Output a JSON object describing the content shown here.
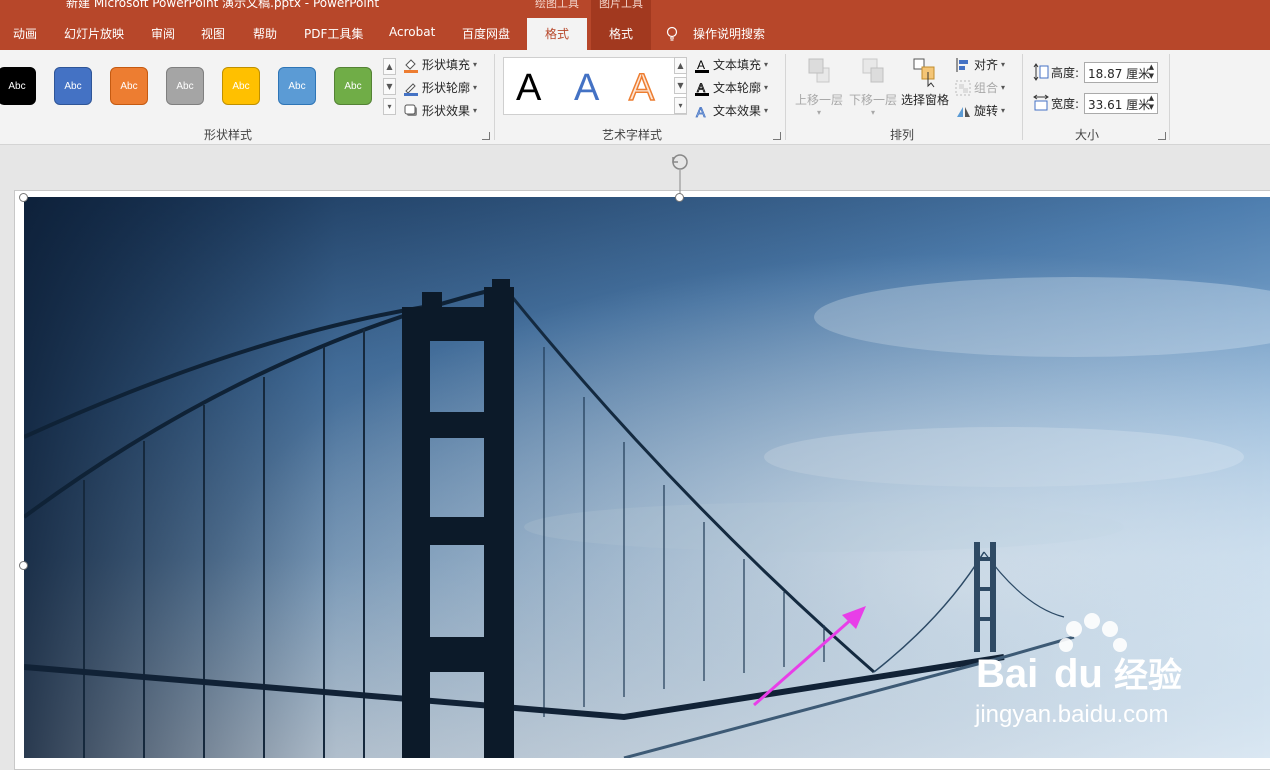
{
  "window": {
    "title": "新建 Microsoft PowerPoint 演示文稿.pptx  -  PowerPoint"
  },
  "context_tabs": {
    "drawing_tools": "绘图工具",
    "picture_tools": "图片工具"
  },
  "tabs": [
    "动画",
    "幻灯片放映",
    "审阅",
    "视图",
    "帮助",
    "PDF工具集",
    "Acrobat",
    "百度网盘"
  ],
  "active_tab": "格式",
  "picture_tab": "格式",
  "tell_me": "操作说明搜索",
  "shape_styles": {
    "label": "形状样式",
    "swatches": [
      {
        "text": "Abc",
        "color": "#000000"
      },
      {
        "text": "Abc",
        "color": "#4472c4"
      },
      {
        "text": "Abc",
        "color": "#ed7d31"
      },
      {
        "text": "Abc",
        "color": "#a5a5a5"
      },
      {
        "text": "Abc",
        "color": "#ffc000"
      },
      {
        "text": "Abc",
        "color": "#5b9bd5"
      },
      {
        "text": "Abc",
        "color": "#70ad47"
      }
    ],
    "fill": "形状填充",
    "outline": "形状轮廓",
    "effects": "形状效果"
  },
  "wordart": {
    "label": "艺术字样式",
    "samples": [
      "A",
      "A",
      "A"
    ],
    "text_fill": "文本填充",
    "text_outline": "文本轮廓",
    "text_effects": "文本效果"
  },
  "arrange": {
    "label": "排列",
    "bring_forward": "上移一层",
    "send_backward": "下移一层",
    "selection_pane": "选择窗格",
    "align": "对齐",
    "group": "组合",
    "rotate": "旋转"
  },
  "size": {
    "label": "大小",
    "height_label": "高度:",
    "height_value": "18.87 厘米",
    "width_label": "宽度:",
    "width_value": "33.61 厘米"
  },
  "watermark": {
    "brand_a": "Bai",
    "brand_b": "du",
    "brand_c": "经验",
    "url": "jingyan.baidu.com"
  },
  "colors": {
    "accent": "#b7472a",
    "arrow": "#e83ee8"
  }
}
